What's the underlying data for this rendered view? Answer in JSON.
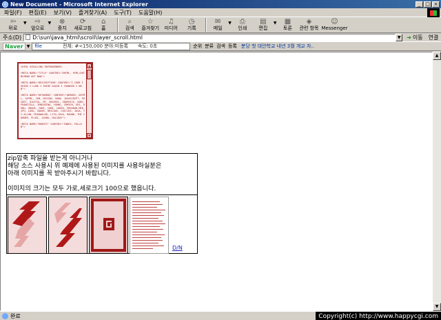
{
  "window": {
    "title": "New Document - Microsoft Internet Explorer",
    "minimize": "_",
    "maximize": "□",
    "close": "×"
  },
  "menu": [
    "파일(F)",
    "편집(E)",
    "보기(V)",
    "즐겨찾기(A)",
    "도구(T)",
    "도움말(H)"
  ],
  "toolbar": {
    "back": "뒤로",
    "forward": "앞으로",
    "stop": "중지",
    "refresh": "새로고침",
    "home": "홈",
    "search": "검색",
    "favorites": "즐겨찾기",
    "media": "미디어",
    "history": "기록",
    "mail": "메일",
    "print": "인쇄",
    "edit": "편집",
    "discuss": "토론",
    "related": "관련 항목",
    "messenger": "Messenger"
  },
  "address": {
    "label": "주소(D)",
    "value": "D:\\sun\\java_html\\scroll\\layer_scroll.html",
    "go": "이동",
    "links": "연결"
  },
  "naver": {
    "logo": "Naver",
    "query": "file",
    "meta": "전체: #<150,000  분야:미등록",
    "speed": "속도: 0초",
    "buttons": [
      "순위",
      "분류",
      "검색",
      "등록"
    ],
    "news": "분당 첫 대안학교 내년 3월 개교 자.."
  },
  "layer": {
    "text": "<HTML SCROLLING ENTERNERNER>\n\n<META NAME=\"TITLE\" CONTENT=\"DHTML, HTML/DHTMLMENU OUT NOW\">\n\n<META NAME=\"DESCRIPTION\" CONTENT=\"I COME I SHIDE.I LOOK I SHIDE AGAIN I CHANGED I WON\">\n\n<META NAME=\"KEYWORDS\" CONTENT=\"WEBDEV, DHTML, SHTML, COM, DESIGN, SHOW, JAVASCRIPT, POCKET, DIGITAL, MY, GRAPHIC, GRAPHICS, GOBY, FRANCISLA, JENGOSINA, YOUNG, CRMISH, GRI, DENU, GRAUR, CODE, CODE, CODER, PROGRAM-MER, JPG, LOGO, SOOUR, DRICOUS, CRICIUS, JAVA, TI-ALLUN, MCDOWALOR, LYTA-JAVA, ROUND, THE CORNER, PLUGI, JAVBA, HOLIDAY\">\n\n<META NAME=\"ROBOTS\" CONTENT=\"INDEX, FOLLOW\">"
  },
  "box": {
    "lines": [
      "zip압축 파일을 받는게 아니거나",
      "해당 소스 사용시 위 예제에 사용된 이미지를 사용하실분은",
      "아래 이미지를 꼭 받아주시기 바랍니다.",
      "이미지의 크기는 모두 가로,세로크기 100으로 했읍니다."
    ],
    "download_link": "D/N"
  },
  "status": {
    "text": "완료",
    "copyright": "Copyright(c) http://www.happycgi.com"
  },
  "colors": {
    "accent_red": "#a02020",
    "light_red": "#e6b4b4",
    "title_bar": "#0a246a"
  }
}
